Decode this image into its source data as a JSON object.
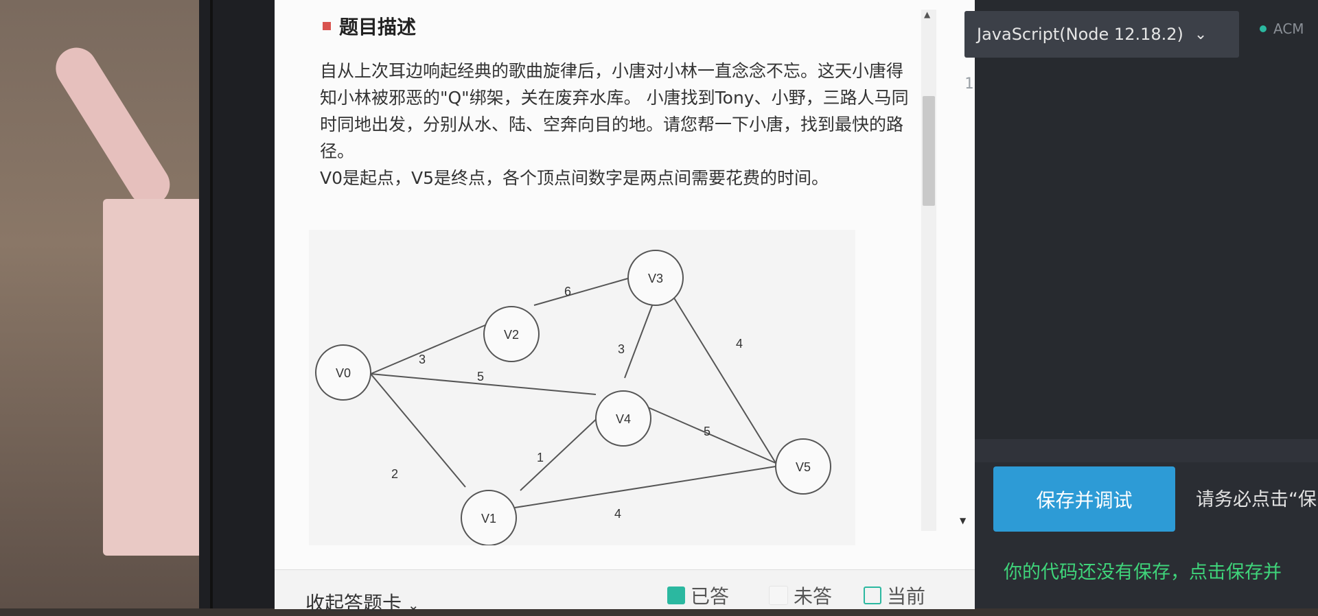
{
  "question": {
    "title": "题目描述",
    "paragraphs": [
      "自从上次耳边响起经典的歌曲旋律后，小唐对小林一直念念不忘。这天小唐得知小林被邪恶的\"Q\"绑架，关在废弃水库。 小唐找到Tony、小野，三路人马同时同地出发，分别从水、陆、空奔向目的地。请您帮一下小唐，找到最快的路径。",
      "V0是起点，V5是终点，各个顶点间数字是两点间需要花费的时间。"
    ],
    "graph": {
      "nodes": [
        "V0",
        "V1",
        "V2",
        "V3",
        "V4",
        "V5"
      ],
      "edges": [
        {
          "from": "V0",
          "to": "V2",
          "weight": "3"
        },
        {
          "from": "V0",
          "to": "V4",
          "weight": "5"
        },
        {
          "from": "V0",
          "to": "V1",
          "weight": "2"
        },
        {
          "from": "V2",
          "to": "V3",
          "weight": "6"
        },
        {
          "from": "V4",
          "to": "V3",
          "weight": "3"
        },
        {
          "from": "V3",
          "to": "V5",
          "weight": "4"
        },
        {
          "from": "V1",
          "to": "V4",
          "weight": "1"
        },
        {
          "from": "V4",
          "to": "V5",
          "weight": "5"
        },
        {
          "from": "V1",
          "to": "V5",
          "weight": "4"
        }
      ]
    }
  },
  "answer_card": {
    "collapse_label": "收起答题卡",
    "legend": [
      {
        "label": "已答",
        "color": "#2bb8a0"
      },
      {
        "label": "未答",
        "color": "#f3f3f3"
      },
      {
        "label": "当前",
        "color": "#2bb8a0"
      }
    ]
  },
  "editor": {
    "language": "JavaScript(Node 12.18.2)",
    "mode_label": "ACM",
    "line_numbers": [
      "1"
    ]
  },
  "actions": {
    "save_debug_label": "保存并调试",
    "hint": "请务必点击“保",
    "unsaved_notice": "你的代码还没有保存，点击保存并"
  },
  "colors": {
    "accent_blue": "#2d9bd6",
    "accent_teal": "#2bb8a0",
    "notice_green": "#3fd47a",
    "title_mark": "#d9534f"
  }
}
